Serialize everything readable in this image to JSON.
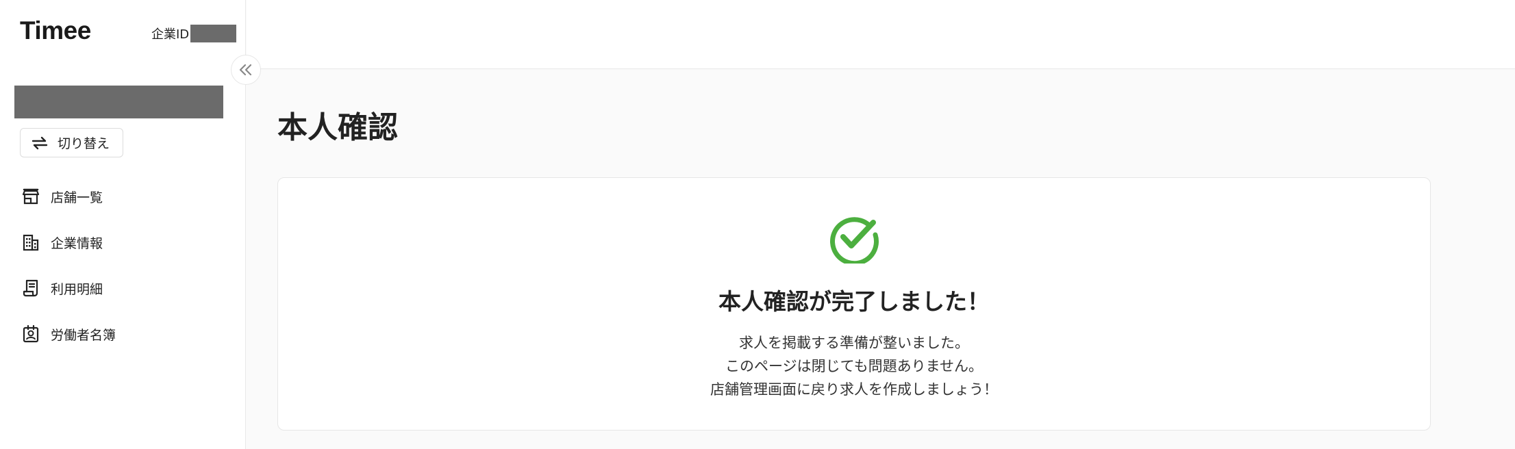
{
  "sidebar": {
    "logo": "Timee",
    "company_id_label": "企業ID",
    "switch_label": "切り替え",
    "items": [
      {
        "label": "店舗一覧",
        "icon": "store-icon"
      },
      {
        "label": "企業情報",
        "icon": "building-icon"
      },
      {
        "label": "利用明細",
        "icon": "receipt-icon"
      },
      {
        "label": "労働者名簿",
        "icon": "id-badge-icon"
      }
    ],
    "collapse_icon": "chevrons-left-icon"
  },
  "main": {
    "title": "本人確認",
    "card": {
      "status_icon": "check-circle-icon",
      "heading": "本人確認が完了しました！",
      "lines": [
        "求人を掲載する準備が整いました。",
        "このページは閉じても問題ありません。",
        "店舗管理画面に戻り求人を作成しましょう！"
      ]
    }
  },
  "colors": {
    "accent_green": "#4caf3f",
    "redaction": "#6b6b6b"
  }
}
